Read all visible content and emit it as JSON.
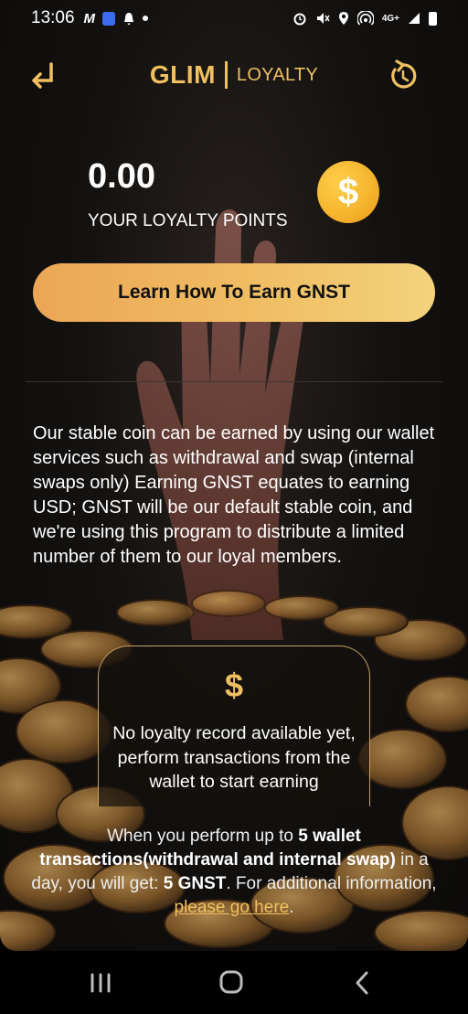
{
  "status_bar": {
    "time": "13:06",
    "left_icons": [
      "m-app-icon",
      "shield-icon",
      "bell-icon",
      "dot-icon"
    ],
    "right_icons": [
      "alarm-icon",
      "mute-icon",
      "location-icon",
      "hotspot-icon",
      "4g-signal-icon",
      "signal-icon",
      "battery-icon"
    ],
    "network": "4G+"
  },
  "header": {
    "brand": "GLIM",
    "section": "LOYALTY",
    "back_icon": "return-arrow-icon",
    "refresh_icon": "refresh-icon"
  },
  "points": {
    "value": "0.00",
    "label": "YOUR LOYALTY POINTS",
    "badge_symbol": "$"
  },
  "cta": {
    "label": "Learn How To Earn GNST"
  },
  "description": "Our stable coin can be earned by using our wallet services such as withdrawal and swap (internal swaps only) Earning GNST equates to earning USD; GNST will be our default stable coin, and we're using this program to distribute a limited number of them to our loyal members.",
  "record": {
    "symbol": "$",
    "message": "No loyalty record available yet, perform transactions from the wallet to start earning"
  },
  "footer": {
    "part1": "When you perform up to ",
    "bold1": "5 wallet transactions(withdrawal and internal swap)",
    "part2": " in a day, you will get: ",
    "bold2": "5 GNST",
    "part3": ". For additional information, ",
    "link": "please go here",
    "part4": "."
  },
  "colors": {
    "accent": "#f0c060",
    "cta_start": "#eba656",
    "cta_end": "#f4d27d",
    "background": "#0b0a09"
  },
  "navbar": {
    "icons": [
      "recent-apps-icon",
      "home-icon",
      "back-icon"
    ]
  }
}
